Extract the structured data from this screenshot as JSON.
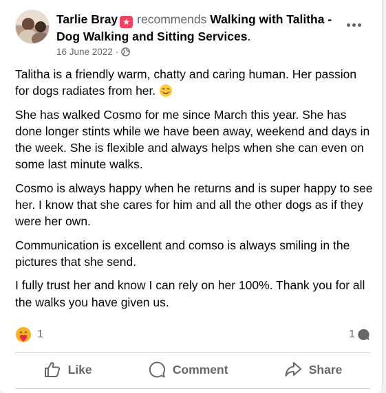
{
  "post": {
    "author": "Tarlie Bray",
    "recommends_word": "recommends",
    "page_name": "Walking with Talitha - Dog Walking and Sitting Services",
    "period": ".",
    "date": "16 June 2022",
    "separator": "·",
    "paragraphs": [
      "Talitha is a friendly warm, chatty and caring human. Her passion for dogs radiates from her.",
      "She has walked Cosmo for me since March this year. She has done longer stints while we have been away, weekend and days in the week. She is flexible and always helps when she can even on some last minute walks.",
      "Cosmo is always happy when he returns and is super happy to see her. I know that she cares for him and all the other dogs as if they were her own.",
      "Communication is excellent and comso is always smiling in the pictures that she send.",
      "I fully trust her and know I can rely on her 100%. Thank you for all the walks you have given us."
    ]
  },
  "reactions": {
    "reaction_count": "1",
    "comment_count": "1"
  },
  "actions": {
    "like": "Like",
    "comment": "Comment",
    "share": "Share"
  },
  "colors": {
    "text": "#050505",
    "secondary": "#65676b",
    "badge": "#f3425f",
    "divider": "#ced0d4"
  },
  "icons": {
    "badge": "recommendation-star-icon",
    "privacy": "globe-icon",
    "reaction": "care-reaction-icon",
    "comment_count": "comment-bubble-icon",
    "like": "thumbs-up-icon",
    "comment": "comment-icon",
    "share": "share-arrow-icon",
    "menu": "more-dots-icon"
  }
}
